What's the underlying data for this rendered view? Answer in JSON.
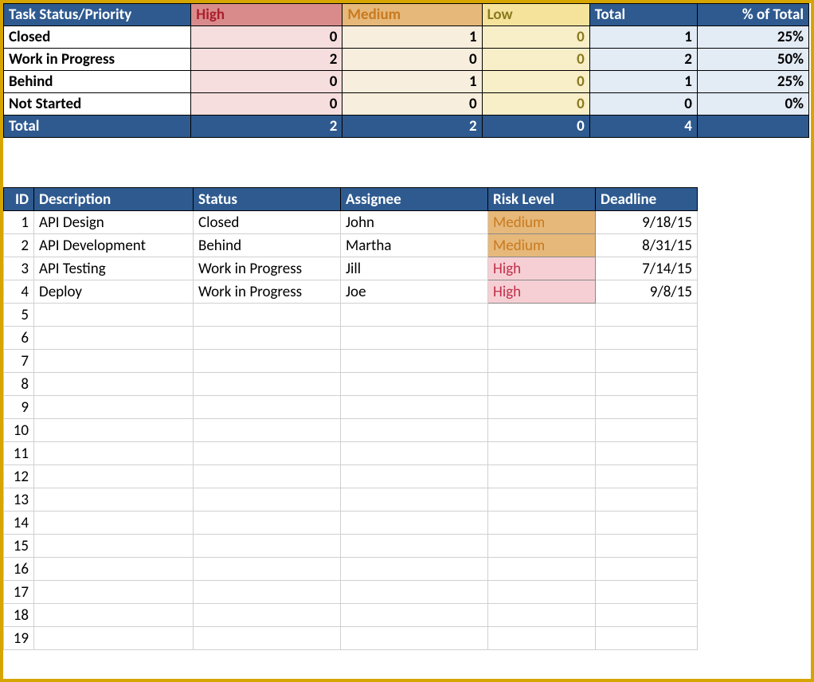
{
  "summary": {
    "corner": "Task Status/Priority",
    "priorities": [
      "High",
      "Medium",
      "Low"
    ],
    "totals_header": "Total",
    "pct_header": "% of Total",
    "rows": [
      {
        "label": "Closed",
        "high": 0,
        "medium": 1,
        "low": 0,
        "total": 1,
        "pct": "25%"
      },
      {
        "label": "Work in Progress",
        "high": 2,
        "medium": 0,
        "low": 0,
        "total": 2,
        "pct": "50%"
      },
      {
        "label": "Behind",
        "high": 0,
        "medium": 1,
        "low": 0,
        "total": 1,
        "pct": "25%"
      },
      {
        "label": "Not Started",
        "high": 0,
        "medium": 0,
        "low": 0,
        "total": 0,
        "pct": "0%"
      }
    ],
    "totals": {
      "label": "Total",
      "high": 2,
      "medium": 2,
      "low": 0,
      "total": 4,
      "pct": ""
    }
  },
  "tasks": {
    "headers": {
      "id": "ID",
      "description": "Description",
      "status": "Status",
      "assignee": "Assignee",
      "risk": "Risk Level",
      "deadline": "Deadline"
    },
    "rows": [
      {
        "id": 1,
        "description": "API Design",
        "status": "Closed",
        "assignee": "John",
        "risk": "Medium",
        "deadline": "9/18/15"
      },
      {
        "id": 2,
        "description": "API Development",
        "status": "Behind",
        "assignee": "Martha",
        "risk": "Medium",
        "deadline": "8/31/15"
      },
      {
        "id": 3,
        "description": "API Testing",
        "status": "Work in Progress",
        "assignee": "Jill",
        "risk": "High",
        "deadline": "7/14/15"
      },
      {
        "id": 4,
        "description": "Deploy",
        "status": "Work in Progress",
        "assignee": "Joe",
        "risk": "High",
        "deadline": "9/8/15"
      },
      {
        "id": 5,
        "description": "",
        "status": "",
        "assignee": "",
        "risk": "",
        "deadline": ""
      },
      {
        "id": 6,
        "description": "",
        "status": "",
        "assignee": "",
        "risk": "",
        "deadline": ""
      },
      {
        "id": 7,
        "description": "",
        "status": "",
        "assignee": "",
        "risk": "",
        "deadline": ""
      },
      {
        "id": 8,
        "description": "",
        "status": "",
        "assignee": "",
        "risk": "",
        "deadline": ""
      },
      {
        "id": 9,
        "description": "",
        "status": "",
        "assignee": "",
        "risk": "",
        "deadline": ""
      },
      {
        "id": 10,
        "description": "",
        "status": "",
        "assignee": "",
        "risk": "",
        "deadline": ""
      },
      {
        "id": 11,
        "description": "",
        "status": "",
        "assignee": "",
        "risk": "",
        "deadline": ""
      },
      {
        "id": 12,
        "description": "",
        "status": "",
        "assignee": "",
        "risk": "",
        "deadline": ""
      },
      {
        "id": 13,
        "description": "",
        "status": "",
        "assignee": "",
        "risk": "",
        "deadline": ""
      },
      {
        "id": 14,
        "description": "",
        "status": "",
        "assignee": "",
        "risk": "",
        "deadline": ""
      },
      {
        "id": 15,
        "description": "",
        "status": "",
        "assignee": "",
        "risk": "",
        "deadline": ""
      },
      {
        "id": 16,
        "description": "",
        "status": "",
        "assignee": "",
        "risk": "",
        "deadline": ""
      },
      {
        "id": 17,
        "description": "",
        "status": "",
        "assignee": "",
        "risk": "",
        "deadline": ""
      },
      {
        "id": 18,
        "description": "",
        "status": "",
        "assignee": "",
        "risk": "",
        "deadline": ""
      },
      {
        "id": 19,
        "description": "",
        "status": "",
        "assignee": "",
        "risk": "",
        "deadline": ""
      }
    ]
  }
}
